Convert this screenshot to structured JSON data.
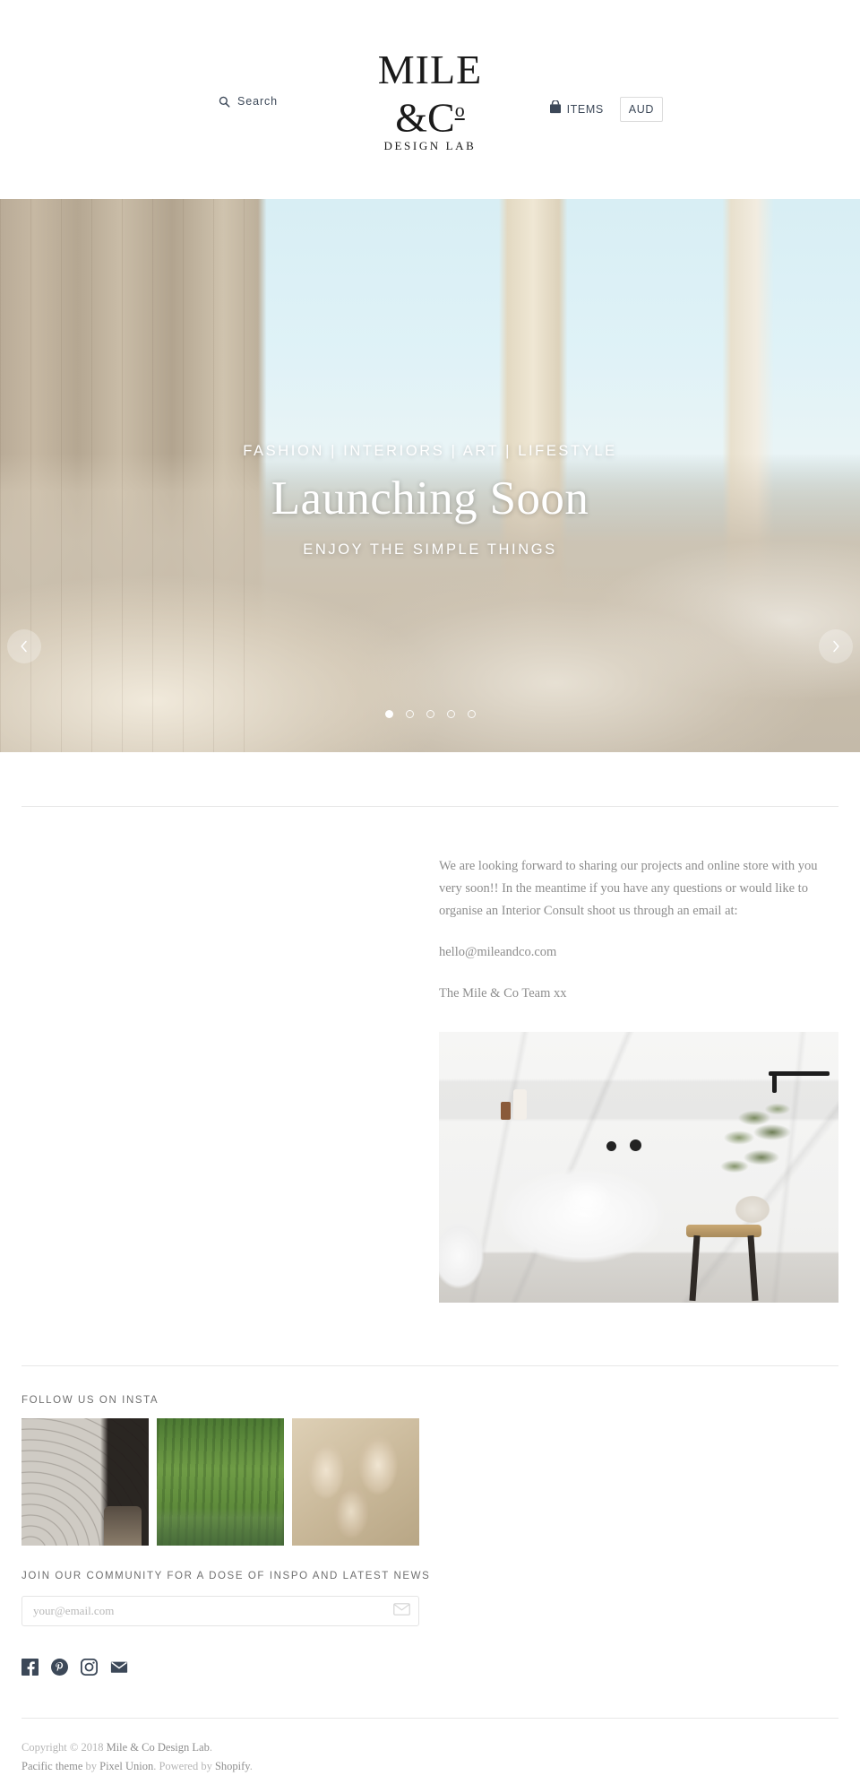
{
  "header": {
    "search": {
      "label": "Search",
      "icon": "search-icon"
    },
    "logo": {
      "line1": "MILE",
      "line2": "&C",
      "line2_sup": "o",
      "subtitle": "DESIGN LAB"
    },
    "cart": {
      "icon": "shopping-bag-icon",
      "label": "ITEMS"
    },
    "currency": {
      "value": "AUD"
    }
  },
  "hero": {
    "kicker": "FASHION | INTERIORS | ART | LIFESTYLE",
    "title": "Launching Soon",
    "subtitle": "ENJOY THE SIMPLE THINGS",
    "prev_icon": "chevron-left-icon",
    "next_icon": "chevron-right-icon",
    "slide_count": 5,
    "active_slide": 1,
    "image_alt": "Bedroom with sheepskin bedding, sheer curtains and ocean view through windows"
  },
  "main": {
    "paragraph_1": "We are looking forward to sharing our projects and online store with you very soon!! In the meantime if you have any questions or would like to organise an Interior Consult shoot us through an email at:",
    "paragraph_2": "hello@mileandco.com",
    "paragraph_3": "The Mile & Co Team xx",
    "image_alt": "White marble bathroom with freestanding bath, black tapware and potted plant on timber stool"
  },
  "instagram": {
    "heading": "FOLLOW US ON INSTA",
    "thumbs": [
      {
        "alt": "Cobblestone paving around a cast iron lamp post base"
      },
      {
        "alt": "Green willow trees reflected in still water"
      },
      {
        "alt": "Carved stone relief sculpture of robed figures"
      }
    ]
  },
  "newsletter": {
    "heading": "JOIN OUR COMMUNITY FOR A DOSE OF INSPO AND LATEST NEWS",
    "placeholder": "your@email.com",
    "value": "",
    "submit_icon": "envelope-icon"
  },
  "social": [
    {
      "name": "facebook-icon",
      "label": "Facebook"
    },
    {
      "name": "pinterest-icon",
      "label": "Pinterest"
    },
    {
      "name": "instagram-icon",
      "label": "Instagram"
    },
    {
      "name": "email-icon",
      "label": "Email"
    }
  ],
  "footer": {
    "copyright_prefix": "Copyright © 2018",
    "store_name": "Mile & Co Design Lab",
    "copyright_suffix": ".",
    "theme_prefix": "Pacific theme",
    "by": "by",
    "theme_author": "Pixel Union",
    "powered_prefix": ". Powered by",
    "platform": "Shopify",
    "powered_suffix": "."
  },
  "colors": {
    "text_dark": "#3c4858",
    "text_muted": "#8d8d8d",
    "text_light": "#b5b5b5",
    "rule": "#e7e7e7",
    "white": "#ffffff"
  }
}
